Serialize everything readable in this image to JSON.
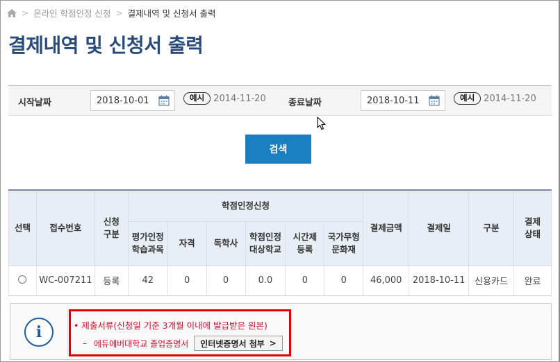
{
  "breadcrumb": {
    "items": [
      "온라인 학점인정 신청",
      "결제내역 및 신청서 출력"
    ],
    "separator": ">"
  },
  "page_title": "결제내역 및 신청서 출력",
  "search": {
    "start_label": "시작날짜",
    "start_value": "2018-10-01",
    "start_example_tag": "예시",
    "start_example_value": "2014-11-20",
    "end_label": "종료날짜",
    "end_value": "2018-10-11",
    "end_example_tag": "예시",
    "end_example_value": "2014-11-20",
    "button_label": "검색"
  },
  "table": {
    "headers": {
      "select": "선택",
      "receipt_no": "접수번호",
      "apply_type": "신청\n구분",
      "credit_group": "학점인정신청",
      "eval_course": "평가인정\n학습과목",
      "license": "자격",
      "self_study": "독학사",
      "credit_school": "학점인정\n대상학교",
      "part_time": "시간제\n등록",
      "heritage": "국가무형\n문화재",
      "amount": "결제금액",
      "pay_date": "결제일",
      "category": "구분",
      "pay_status": "결제\n상태"
    },
    "rows": [
      {
        "receipt_no": "WC-007211",
        "apply_type": "등록",
        "eval_course": "42",
        "license": "0",
        "self_study": "0",
        "credit_school": "0.0",
        "part_time": "0",
        "heritage": "0",
        "amount": "46,000",
        "pay_date": "2018-10-11",
        "category": "신용카드",
        "pay_status": "완료"
      }
    ]
  },
  "info": {
    "icon": "info-icon",
    "line1": "• 제출서류(신청일 기준 3개월 이내에 발급받은 원본)",
    "line2_dash": "–",
    "line2": "에듀에버대학교 졸업증명서",
    "cert_button": "인터넷증명서 첨부",
    "cert_button_chevron": ">"
  },
  "colors": {
    "title": "#2a4a7a",
    "button": "#1a7fc1",
    "notice": "#c8102e",
    "highlight": "#e00000"
  }
}
